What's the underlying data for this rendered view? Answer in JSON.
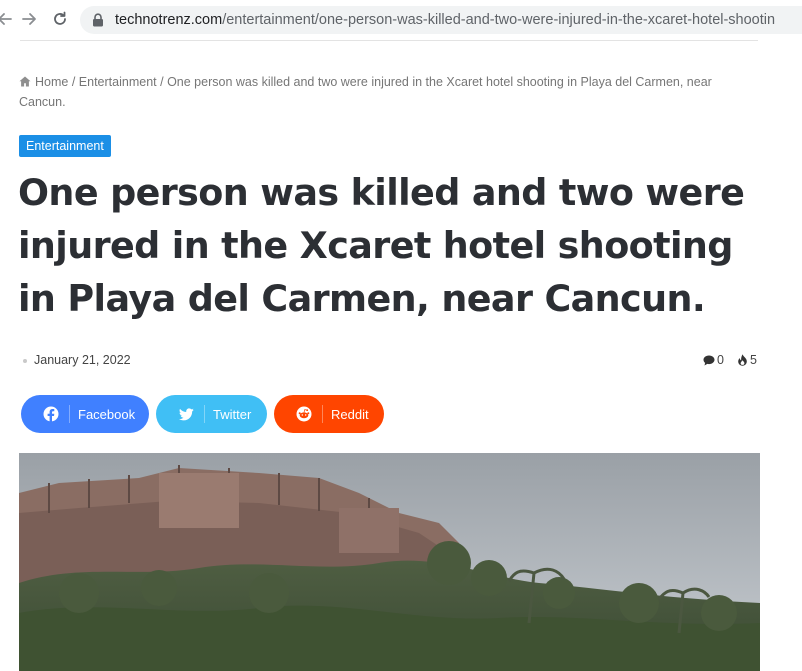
{
  "browser": {
    "url_host": "technotrenz.com",
    "url_path": "/entertainment/one-person-was-killed-and-two-were-injured-in-the-xcaret-hotel-shootin"
  },
  "breadcrumb": {
    "home": "Home",
    "separator": "/",
    "category": "Entertainment",
    "current": "One person was killed and two were injured in the Xcaret hotel shooting in Playa del Carmen, near Cancun."
  },
  "post": {
    "category": "Entertainment",
    "title": "One person was killed and two were injured in the Xcaret hotel shooting in Playa del Carmen, near Cancun.",
    "date": "January 21, 2022",
    "comments": "0",
    "views": "5"
  },
  "share": {
    "facebook": "Facebook",
    "twitter": "Twitter",
    "reddit": "Reddit"
  },
  "colors": {
    "category_badge": "#1b8fe6",
    "facebook": "#4080ff",
    "twitter": "#40bff5",
    "reddit": "#ff4500",
    "title_text": "#2c2f34"
  },
  "icons": [
    "back-icon",
    "forward-icon",
    "reload-icon",
    "lock-icon",
    "home-icon",
    "comment-icon",
    "fire-icon",
    "facebook-icon",
    "twitter-icon",
    "reddit-icon"
  ]
}
